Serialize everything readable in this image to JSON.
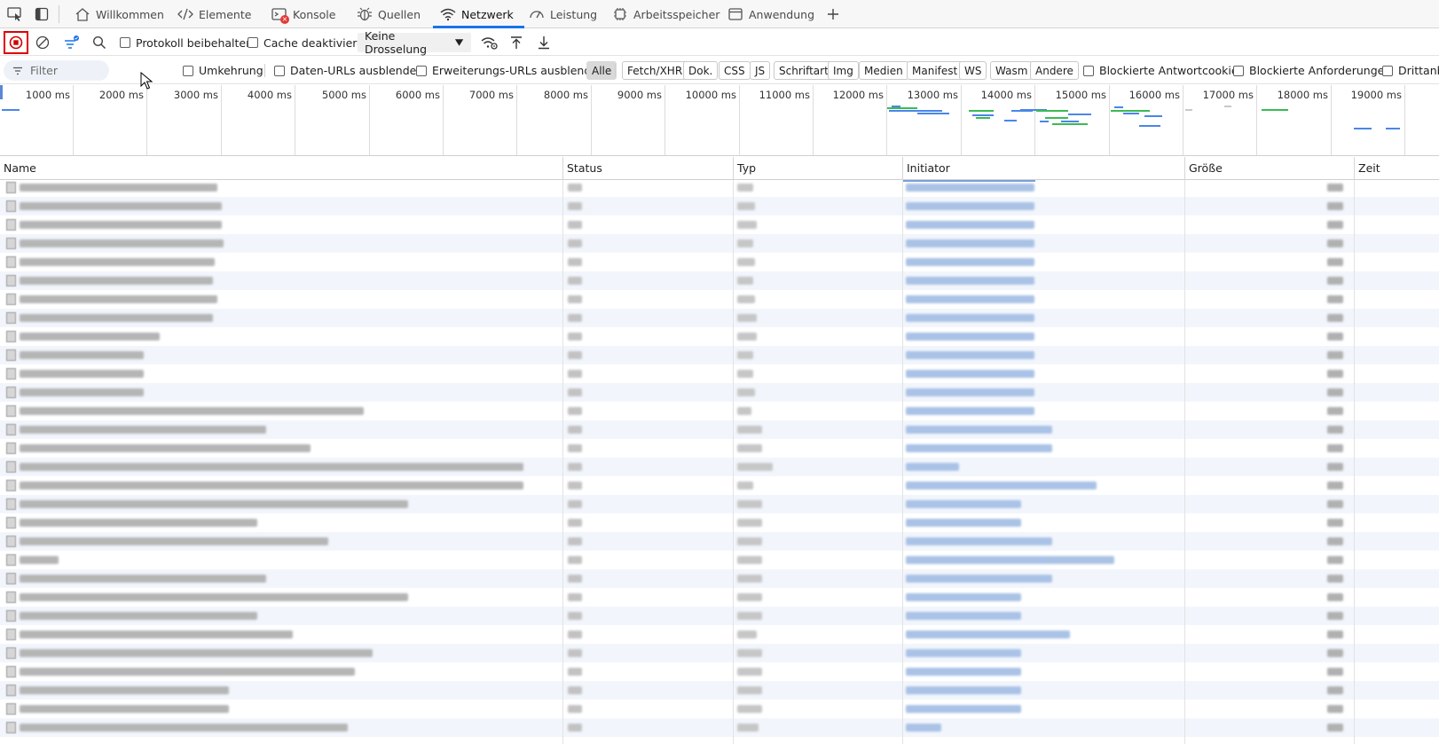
{
  "tabs": [
    {
      "label": "Willkommen",
      "icon": "home-icon"
    },
    {
      "label": "Elemente",
      "icon": "code-icon"
    },
    {
      "label": "Konsole",
      "icon": "console-icon"
    },
    {
      "label": "Quellen",
      "icon": "bug-icon"
    },
    {
      "label": "Netzwerk",
      "icon": "wifi-icon",
      "active": true
    },
    {
      "label": "Leistung",
      "icon": "gauge-icon"
    },
    {
      "label": "Arbeitsspeicher",
      "icon": "memory-icon"
    },
    {
      "label": "Anwendung",
      "icon": "window-icon"
    }
  ],
  "toolbar": {
    "preserve_log_label": "Protokoll beibehalten",
    "disable_cache_label": "Cache deaktivieren",
    "throttle_value": "Keine Drosselung",
    "record_color": "#e00000",
    "accent": "#1a73e8"
  },
  "filter": {
    "placeholder": "Filter",
    "invert_label": "Umkehrung",
    "hide_data_urls_label": "Daten-URLs ausblenden",
    "hide_ext_urls_label": "Erweiterungs-URLs ausblenden",
    "types": [
      "Alle",
      "Fetch/XHR",
      "Dok.",
      "CSS",
      "JS",
      "Schriftart",
      "Img",
      "Medien",
      "Manifest",
      "WS",
      "Wasm",
      "Andere"
    ],
    "selected_type": "Alle",
    "blocked_cookies_label": "Blockierte Antwortcookies",
    "blocked_requests_label": "Blockierte Anforderungen",
    "third_party_label": "Drittanbi"
  },
  "overview": {
    "ticks": [
      "1000  ms",
      "2000  ms",
      "3000  ms",
      "4000  ms",
      "5000  ms",
      "6000  ms",
      "7000  ms",
      "8000  ms",
      "9000  ms",
      "10000  ms",
      "11000  ms",
      "12000  ms",
      "13000  ms",
      "14000  ms",
      "15000  ms",
      "16000  ms",
      "17000  ms",
      "18000  ms",
      "19000  ms"
    ]
  },
  "grid": {
    "columns": [
      "Name",
      "Status",
      "Typ",
      "Initiator",
      "Größe",
      "Zeit"
    ],
    "row_count": 30
  }
}
